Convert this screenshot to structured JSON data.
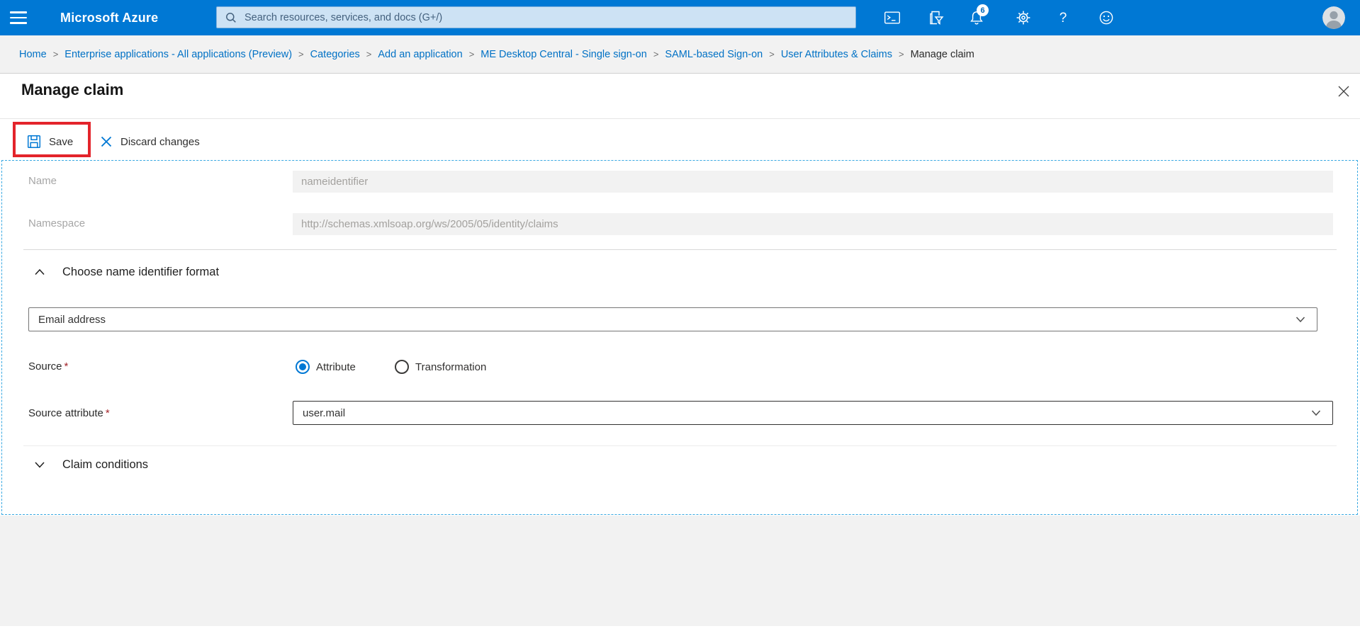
{
  "topbar": {
    "brand": "Microsoft Azure",
    "search_placeholder": "Search resources, services, and docs (G+/)",
    "notification_count": "6",
    "colors": {
      "bar": "#0078d4",
      "search_bg": "#cde2f4"
    }
  },
  "icons": {
    "hamburger": "menu-bars",
    "search": "magnifier",
    "cloud_shell": "terminal-prompt",
    "directory_filter": "panel-with-funnel",
    "notifications": "bell",
    "settings": "gear",
    "help": "question-mark",
    "feedback": "smiley-face",
    "avatar": "person-silhouette",
    "save": "floppy-disk",
    "discard": "x-cross",
    "close": "x-cross",
    "section_collapse": "chevron-up",
    "section_expand": "chevron-down",
    "dropdown": "chevron-down"
  },
  "breadcrumb": {
    "items": [
      "Home",
      "Enterprise applications - All applications (Preview)",
      "Categories",
      "Add an application",
      "ME Desktop Central - Single sign-on",
      "SAML-based Sign-on",
      "User Attributes & Claims",
      "Manage claim"
    ]
  },
  "page": {
    "title": "Manage claim"
  },
  "toolbar": {
    "save_label": "Save",
    "discard_label": "Discard changes",
    "annotation_color": "#e3242b",
    "accent_color": "#0078d4"
  },
  "form": {
    "name": {
      "label": "Name",
      "value": "nameidentifier",
      "disabled": true
    },
    "namespace": {
      "label": "Namespace",
      "value": "http://schemas.xmlsoap.org/ws/2005/05/identity/claims",
      "disabled": true
    },
    "identifier_section": {
      "title": "Choose name identifier format",
      "selected_value": "Email address",
      "expanded": true
    },
    "source": {
      "label": "Source",
      "required_mark": "*",
      "options": [
        "Attribute",
        "Transformation"
      ],
      "selected": "Attribute"
    },
    "source_attribute": {
      "label": "Source attribute",
      "required_mark": "*",
      "value": "user.mail"
    },
    "claim_conditions": {
      "title": "Claim conditions",
      "expanded": false
    }
  }
}
